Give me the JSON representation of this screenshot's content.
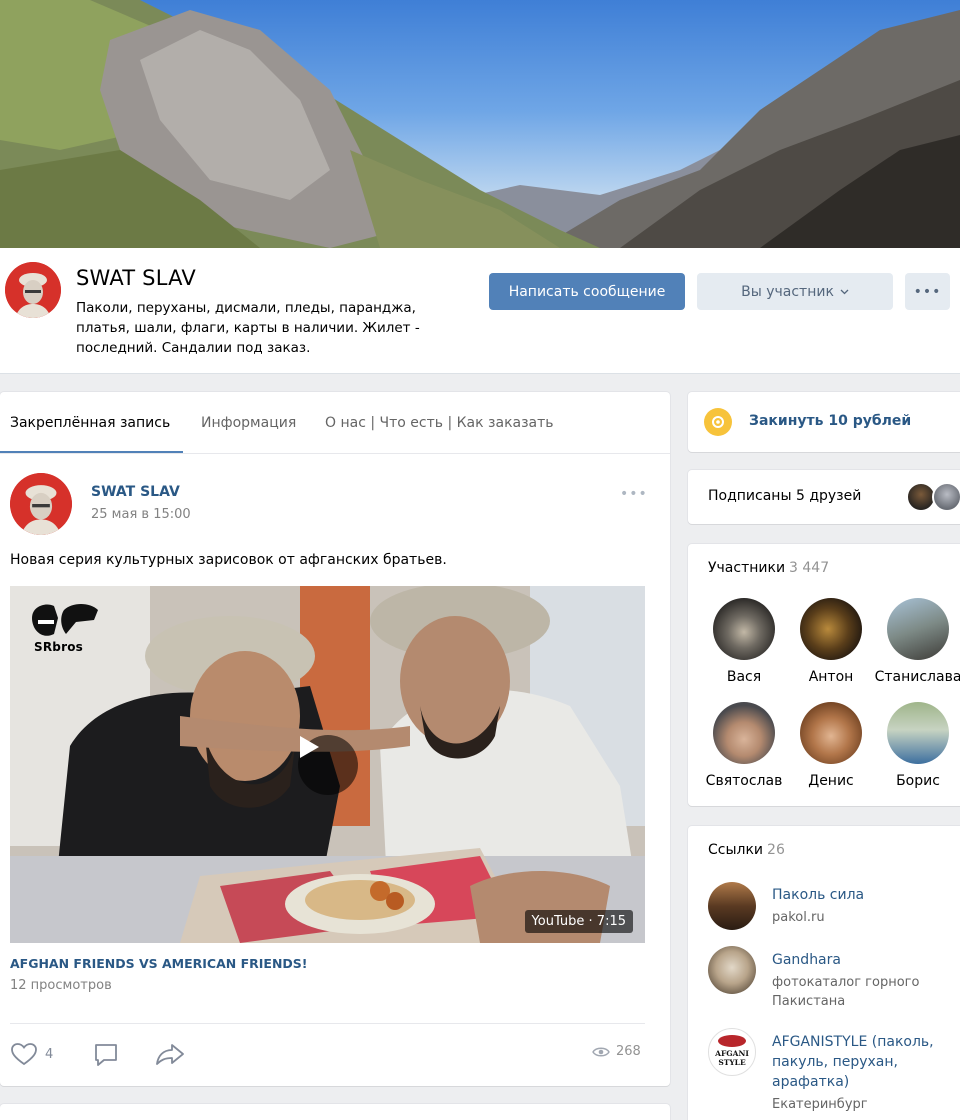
{
  "group": {
    "name": "SWAT SLAV",
    "description": "Паколи, перуханы, дисмали, пледы, паранджа, платья, шали, флаги, карты в наличии. Жилет - последний. Сандалии под заказ.",
    "send_message_label": "Написать сообщение",
    "member_label": "Вы участник",
    "more_label": "•••"
  },
  "tabs": [
    {
      "label": "Закреплённая запись",
      "active": true
    },
    {
      "label": "Информация",
      "active": false
    },
    {
      "label": "О нас | Что есть | Как заказать",
      "active": false
    }
  ],
  "post": {
    "author": "SWAT SLAV",
    "date": "25 мая в 15:00",
    "more": "•••",
    "text": "Новая серия культурных зарисовок от афганских братьев.",
    "video": {
      "title": "AFGHAN FRIENDS VS AMERICAN FRIENDS!",
      "source_badge": "YouTube · 7:15",
      "channel_logo": "SRbros",
      "views_text": "12 просмотров"
    },
    "likes": "4",
    "view_count": "268"
  },
  "sidebar": {
    "donate_label": "Закинуть 10 рублей",
    "friends_label": "Подписаны 5 друзей",
    "members": {
      "title": "Участники",
      "count": "3 447",
      "list": [
        {
          "name": "Вася"
        },
        {
          "name": "Антон"
        },
        {
          "name": "Станислава"
        },
        {
          "name": "Святослав"
        },
        {
          "name": "Денис"
        },
        {
          "name": "Борис"
        }
      ]
    },
    "links": {
      "title": "Ссылки",
      "count": "26",
      "items": [
        {
          "title": "Паколь сила",
          "subtitle": "pakol.ru"
        },
        {
          "title": "Gandhara",
          "subtitle": "фотокаталог горного Пакистана"
        },
        {
          "title": "AFGANISTYLE (паколь, пакуль, перухан, арафатка)",
          "subtitle": "Екатеринбург",
          "logo_text": "AFGANI STYLE"
        }
      ]
    }
  }
}
